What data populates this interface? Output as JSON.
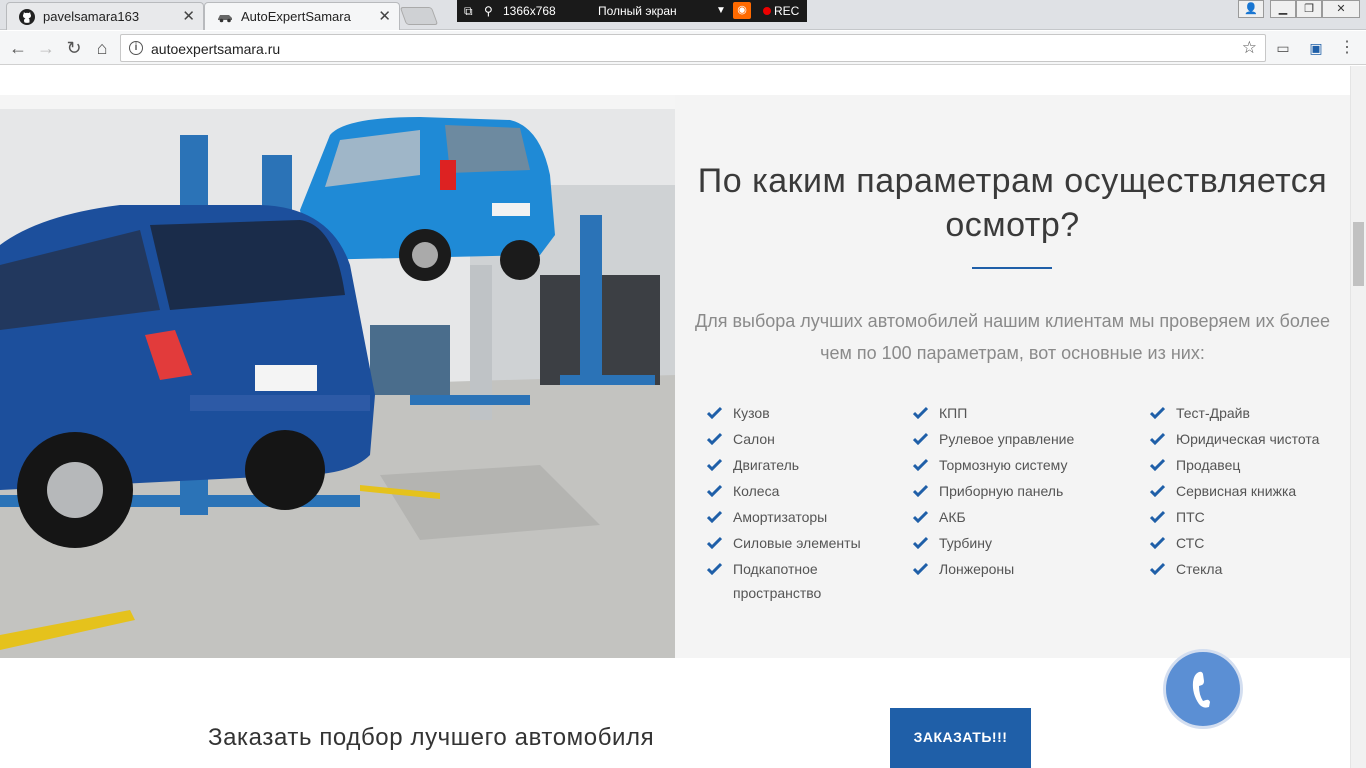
{
  "browser": {
    "tabs": [
      {
        "label": "pavelsamara163",
        "icon": "github-icon"
      },
      {
        "label": "AutoExpertSamara",
        "icon": "site-favicon-icon"
      }
    ],
    "recorder": {
      "resolution": "1366x768",
      "mode": "Полный экран",
      "rec": "REC"
    },
    "url": "autoexpertsamara.ru"
  },
  "section": {
    "heading": "По каким параметрам осуществляется осмотр?",
    "lead": "Для выбора лучших автомобилей нашим клиентам мы проверяем их более чем по 100 параметрам, вот основные из них:",
    "columns": [
      [
        "Кузов",
        "Салон",
        "Двигатель",
        "Колеса",
        "Амортизаторы",
        "Силовые элементы",
        "Подкапотное пространство"
      ],
      [
        "КПП",
        "Рулевое управление",
        "Тормозную систему",
        "Приборную панель",
        "АКБ",
        "Турбину",
        "Лонжероны"
      ],
      [
        "Тест-Драйв",
        "Юридическая чистота",
        "Продавец",
        "Сервисная книжка",
        "ПТС",
        "СТС",
        "Стекла"
      ]
    ],
    "accent_color": "#1f5fa8"
  },
  "cta": {
    "text": "Заказать подбор лучшего автомобиля",
    "button": "ЗАКАЗАТЬ!!!"
  }
}
